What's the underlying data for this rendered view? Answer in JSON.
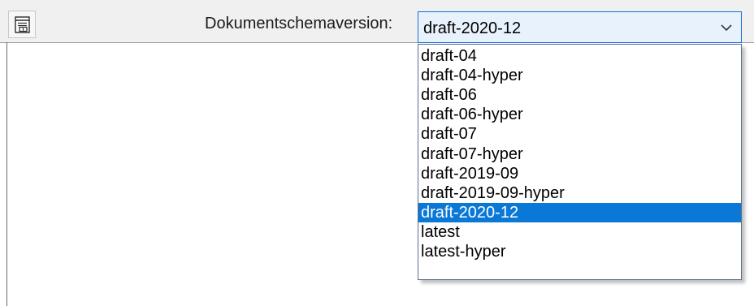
{
  "toolbar": {
    "icon": "document-outline-icon",
    "schema_label": "Dokumentschemaversion:"
  },
  "schema_version_select": {
    "selected": "draft-2020-12",
    "arrow_icon": "chevron-down-icon",
    "accent_color": "#1a6ed9",
    "highlight_color": "#0a78d7",
    "options": [
      "draft-04",
      "draft-04-hyper",
      "draft-06",
      "draft-06-hyper",
      "draft-07",
      "draft-07-hyper",
      "draft-2019-09",
      "draft-2019-09-hyper",
      "draft-2020-12",
      "latest",
      "latest-hyper"
    ]
  }
}
